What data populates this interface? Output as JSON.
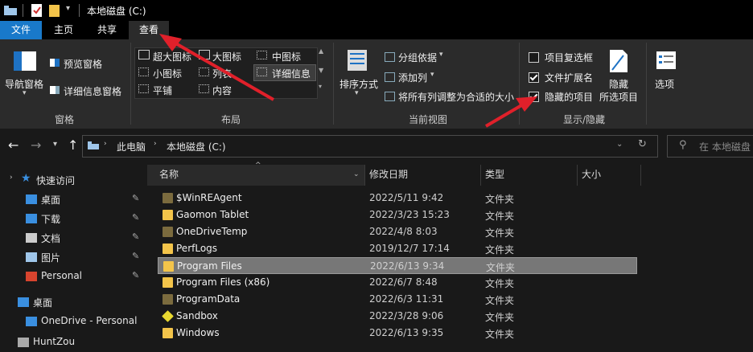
{
  "titlebar": {
    "title": "本地磁盘 (C:)"
  },
  "tabs": {
    "file": "文件",
    "home": "主页",
    "share": "共享",
    "view": "查看"
  },
  "ribbon": {
    "panes": {
      "nav_pane": "导航窗格",
      "preview_pane": "预览窗格",
      "details_pane": "详细信息窗格",
      "group_label": "窗格"
    },
    "layout": {
      "xl_icons": "超大图标",
      "large_icons": "大图标",
      "medium_icons": "中图标",
      "small_icons": "小图标",
      "list": "列表",
      "details": "详细信息",
      "tiles": "平铺",
      "content": "内容",
      "group_label": "布局"
    },
    "current_view": {
      "sort_by": "排序方式",
      "group_by": "分组依据",
      "add_columns": "添加列",
      "size_all_columns": "将所有列调整为合适的大小",
      "group_label": "当前视图"
    },
    "show_hide": {
      "item_checkboxes": "项目复选框",
      "item_checkboxes_checked": false,
      "file_extensions": "文件扩展名",
      "file_extensions_checked": true,
      "hidden_items": "隐藏的项目",
      "hidden_items_checked": true,
      "hide_selected_1": "隐藏",
      "hide_selected_2": "所选项目",
      "options": "选项",
      "group_label": "显示/隐藏"
    }
  },
  "address": {
    "crumb1": "此电脑",
    "crumb2": "本地磁盘 (C:)",
    "search_placeholder": "在 本地磁盘"
  },
  "sidebar": {
    "items": [
      {
        "label": "快速访问",
        "icon": "star-icon"
      },
      {
        "label": "桌面",
        "icon": "desktop-icon",
        "pinned": true
      },
      {
        "label": "下载",
        "icon": "download-icon",
        "pinned": true
      },
      {
        "label": "文档",
        "icon": "document-icon",
        "pinned": true
      },
      {
        "label": "图片",
        "icon": "picture-icon",
        "pinned": true
      },
      {
        "label": "Personal",
        "icon": "app-icon",
        "pinned": true
      },
      {
        "label": "桌面",
        "icon": "desktop-icon"
      },
      {
        "label": "OneDrive - Personal",
        "icon": "cloud-icon"
      },
      {
        "label": "HuntZou",
        "icon": "user-icon"
      }
    ]
  },
  "columns": {
    "name": "名称",
    "modified": "修改日期",
    "type": "类型",
    "size": "大小"
  },
  "files": [
    {
      "name": "$WinREAgent",
      "date": "2022/5/11 9:42",
      "type": "文件夹",
      "hidden": true
    },
    {
      "name": "Gaomon Tablet",
      "date": "2022/3/23 15:23",
      "type": "文件夹"
    },
    {
      "name": "OneDriveTemp",
      "date": "2022/4/8 8:03",
      "type": "文件夹",
      "hidden": true
    },
    {
      "name": "PerfLogs",
      "date": "2019/12/7 17:14",
      "type": "文件夹"
    },
    {
      "name": "Program Files",
      "date": "2022/6/13 9:34",
      "type": "文件夹",
      "selected": true
    },
    {
      "name": "Program Files (x86)",
      "date": "2022/6/7 8:48",
      "type": "文件夹"
    },
    {
      "name": "ProgramData",
      "date": "2022/6/3 11:31",
      "type": "文件夹",
      "hidden": true
    },
    {
      "name": "Sandbox",
      "date": "2022/3/28 9:06",
      "type": "文件夹",
      "special": true
    },
    {
      "name": "Windows",
      "date": "2022/6/13 9:35",
      "type": "文件夹"
    }
  ],
  "colors": {
    "accent": "#1979ca",
    "annotation_arrow": "#e0202a",
    "folder": "#f3c44a",
    "selected_row": "#777777"
  }
}
